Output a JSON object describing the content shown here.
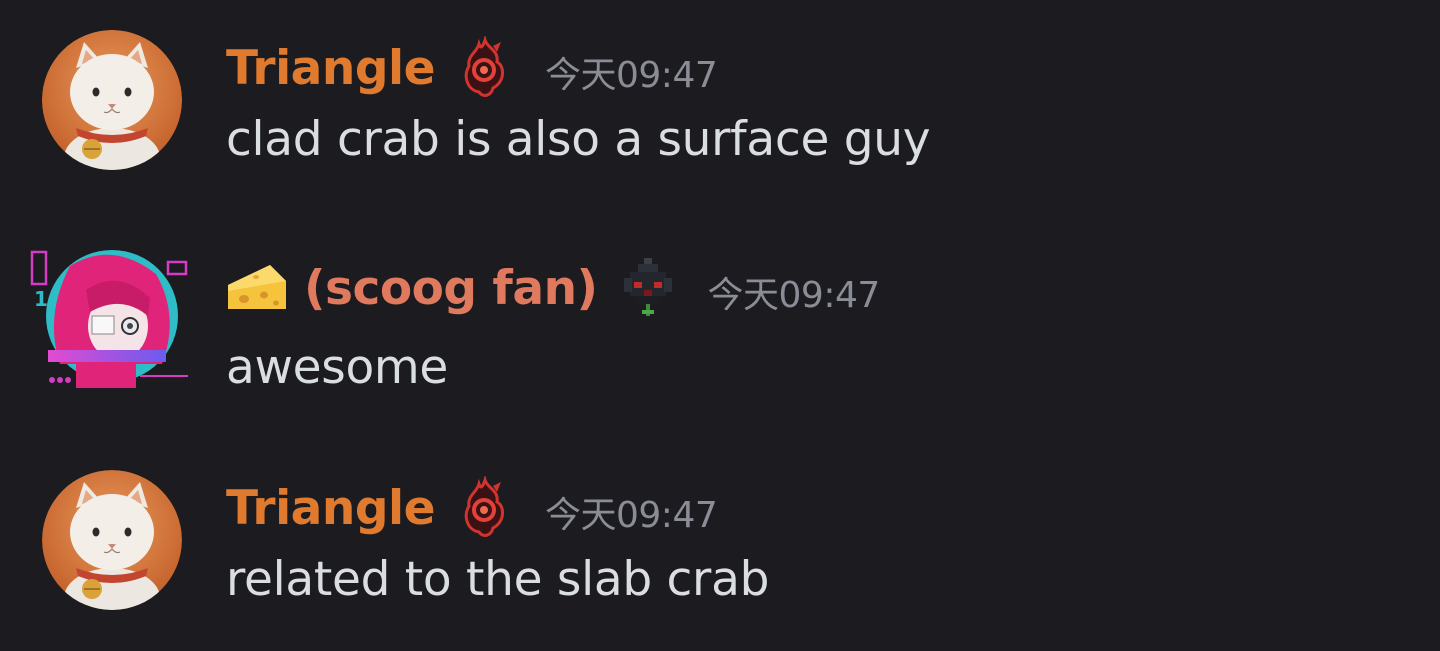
{
  "colors": {
    "background": "#1b1b20",
    "username_orange": "#e07a2e",
    "username_salmon": "#e07a5f",
    "timestamp": "#8b8d96",
    "message_text": "#dbdee1"
  },
  "messages": [
    {
      "username": "Triangle",
      "username_color": "#e07a2e",
      "role_icon": "red-flame-badge-icon",
      "timestamp": "今天09:47",
      "content": "clad crab is also a surface guy",
      "avatar": "white-cat-avatar"
    },
    {
      "prefix_emoji": "cheese-emoji",
      "username": "(scoog fan)",
      "username_color": "#e07a5f",
      "role_icon": "dark-pixel-knight-icon",
      "timestamp": "今天09:47",
      "content": "awesome",
      "avatar": "pink-hair-anime-avatar"
    },
    {
      "username": "Triangle",
      "username_color": "#e07a2e",
      "role_icon": "red-flame-badge-icon",
      "timestamp": "今天09:47",
      "content": "related to the slab crab",
      "avatar": "white-cat-avatar"
    }
  ]
}
